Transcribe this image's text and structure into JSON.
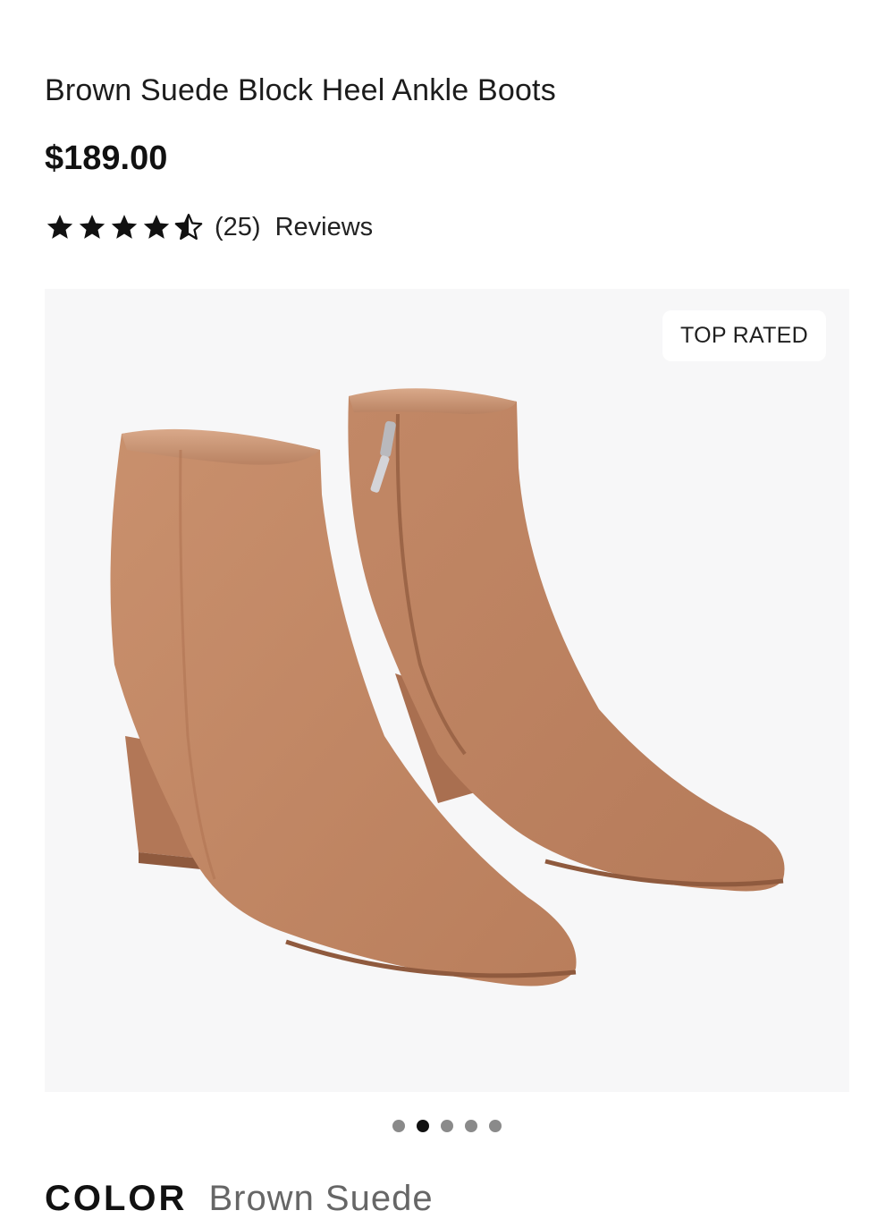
{
  "product": {
    "title": "Brown Suede Block Heel Ankle Boots",
    "price": "$189.00",
    "rating": 4.5,
    "rating_max": 5,
    "review_count": "(25)",
    "reviews_label": "Reviews"
  },
  "gallery": {
    "badge": "TOP RATED",
    "image_icon": "ankle-boots-image",
    "slide_count": 5,
    "active_slide": 2
  },
  "color": {
    "label": "COLOR",
    "value": "Brown Suede"
  },
  "colors": {
    "suede": "#c48a68",
    "background": "#f7f7f8",
    "dot_active": "#111111",
    "dot_inactive": "#8a8a8a"
  }
}
